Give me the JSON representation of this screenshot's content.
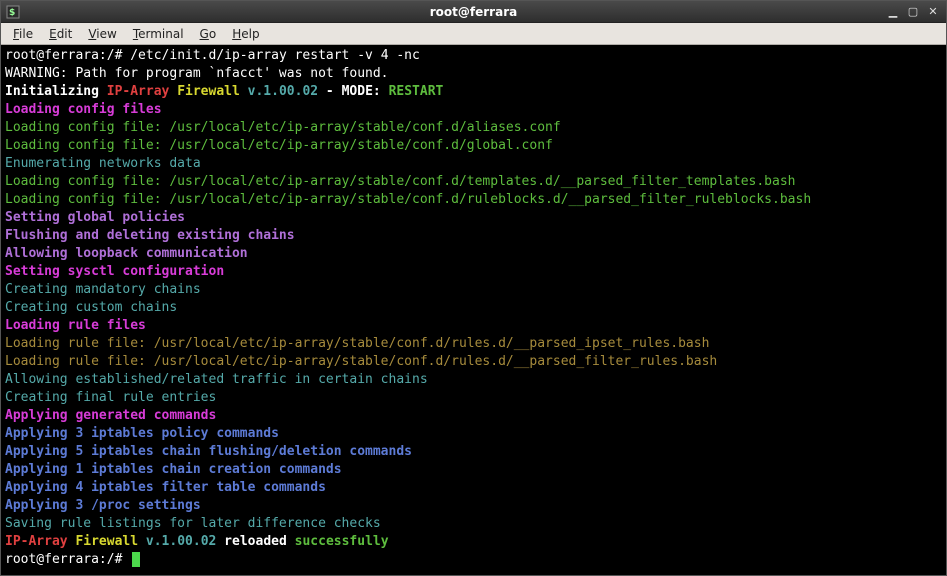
{
  "window": {
    "title": "root@ferrara"
  },
  "menubar": {
    "items": [
      {
        "mnemonic": "F",
        "rest": "ile"
      },
      {
        "mnemonic": "E",
        "rest": "dit"
      },
      {
        "mnemonic": "V",
        "rest": "iew"
      },
      {
        "mnemonic": "T",
        "rest": "erminal"
      },
      {
        "mnemonic": "G",
        "rest": "o"
      },
      {
        "mnemonic": "H",
        "rest": "elp"
      }
    ]
  },
  "terminal": {
    "prompt1": "root@ferrara:/# ",
    "command": "/etc/init.d/ip-array restart -v 4 -nc",
    "warning": "WARNING: Path for program `nfacct' was not found.",
    "init_prefix": "Initializing ",
    "init_ip": "IP-Array",
    "init_fw": " Firewall",
    "init_ver": " v.1.00.02",
    "init_mode": " - MODE: ",
    "init_restart": "RESTART",
    "loading_config_header": "Loading config files",
    "cfg1": "Loading config file: /usr/local/etc/ip-array/stable/conf.d/aliases.conf",
    "cfg2": "Loading config file: /usr/local/etc/ip-array/stable/conf.d/global.conf",
    "enum_net": "Enumerating networks data",
    "cfg3": "Loading config file: /usr/local/etc/ip-array/stable/conf.d/templates.d/__parsed_filter_templates.bash",
    "cfg4": "Loading config file: /usr/local/etc/ip-array/stable/conf.d/ruleblocks.d/__parsed_filter_ruleblocks.bash",
    "set_policies": "Setting global policies",
    "flush_chains": "Flushing and deleting existing chains",
    "allow_loopback": "Allowing loopback communication",
    "set_sysctl": "Setting sysctl configuration",
    "create_mandatory": "Creating mandatory chains",
    "create_custom": "Creating custom chains",
    "loading_rule_header": "Loading rule files",
    "rule1": "Loading rule file: /usr/local/etc/ip-array/stable/conf.d/rules.d/__parsed_ipset_rules.bash",
    "rule2": "Loading rule file: /usr/local/etc/ip-array/stable/conf.d/rules.d/__parsed_filter_rules.bash",
    "allow_established": "Allowing established/related traffic in certain chains",
    "create_final": "Creating final rule entries",
    "apply_header": "Applying generated commands",
    "apply1": "Applying 3 iptables policy commands",
    "apply2": "Applying 5 iptables chain flushing/deletion commands",
    "apply3": "Applying 1 iptables chain creation commands",
    "apply4": "Applying 4 iptables filter table commands",
    "apply5": "Applying 3 /proc settings",
    "saving": "Saving rule listings for later difference checks",
    "final_ip": "IP-Array",
    "final_fw": " Firewall",
    "final_ver": " v.1.00.02",
    "final_reloaded": " reloaded ",
    "final_success": "successfully",
    "prompt2": "root@ferrara:/# "
  }
}
